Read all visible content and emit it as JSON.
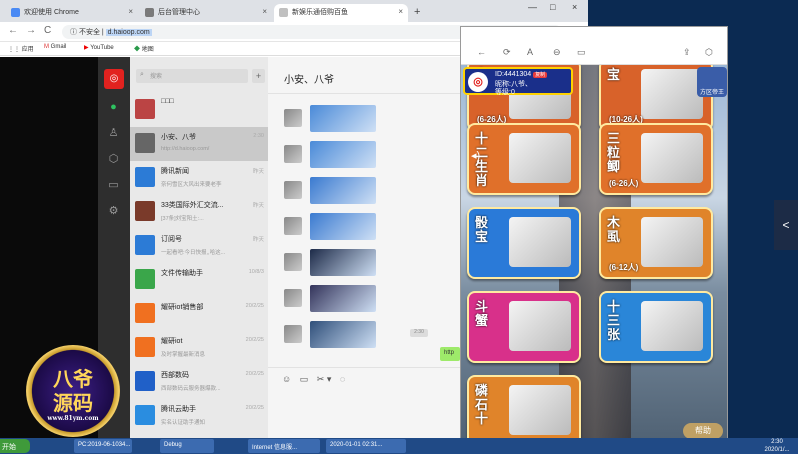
{
  "browser": {
    "tabs": [
      {
        "label": "欢迎使用 Chrome",
        "close": "×"
      },
      {
        "label": "后台管理中心",
        "close": "×"
      },
      {
        "label": "新娱乐通佰购百鱼",
        "close": "×"
      }
    ],
    "new_tab": "+",
    "window_controls": [
      "—",
      "□",
      "×"
    ],
    "nav": {
      "back": "←",
      "forward": "→",
      "reload": "C"
    },
    "address": {
      "security": "不安全",
      "url": "d.haioop.com"
    },
    "bookmarks": [
      "应用",
      "Gmail",
      "YouTube",
      "地图"
    ]
  },
  "wechat": {
    "nav_icons": [
      "chat-icon",
      "contacts-icon",
      "cube-icon",
      "folder-icon",
      "settings-icon"
    ],
    "search_placeholder": "搜索",
    "plus": "+",
    "chats": [
      {
        "name": "□□□",
        "preview": "",
        "time": "",
        "color": "#b44"
      },
      {
        "name": "小安、八爷",
        "preview": "http://d.haioop.com/",
        "time": "2:30",
        "color": "#666",
        "selected": true
      },
      {
        "name": "腾讯新闻",
        "preview": "奈何雪区大风出来要老李",
        "time": "昨天",
        "color": "#2c7bd6"
      },
      {
        "name": "33类国际外汇交流...",
        "preview": "[37条]刘宝阳土:...",
        "time": "昨天",
        "color": "#7a3a2a"
      },
      {
        "name": "订阅号",
        "preview": "一起看吧:今日快报,,哈这...",
        "time": "昨天",
        "color": "#2c7bd6"
      },
      {
        "name": "文件传输助手",
        "preview": "",
        "time": "10/8/3",
        "color": "#3aa64a"
      },
      {
        "name": "耀研iot销售部",
        "preview": "",
        "time": "20/2/25",
        "color": "#f07020"
      },
      {
        "name": "耀研iot",
        "preview": "及时掌握最新消息",
        "time": "20/2/25",
        "color": "#f07020"
      },
      {
        "name": "西部数码",
        "preview": "西部数码云服务器爆款...",
        "time": "20/2/25",
        "color": "#2060c8"
      },
      {
        "name": "腾讯云助手",
        "preview": "实名认证助手通知",
        "time": "20/2/25",
        "color": "#2a8de0"
      },
      {
        "name": "微信团队",
        "preview": "登录操作通知",
        "time": "20/2/25",
        "color": "#2c7bd6"
      }
    ],
    "chat_title": "小安、八爷",
    "time_label": "2:30",
    "outgoing": "http",
    "tools": [
      "☺",
      "▭",
      "✂",
      "▾",
      "◌"
    ]
  },
  "logo": {
    "line1": "八爷",
    "line2": "源码",
    "url": "www.81ym.com"
  },
  "phone": {
    "icons": [
      "←",
      "⟳",
      "A",
      "⊖",
      "▭",
      "⇪",
      "⬡"
    ],
    "profile": {
      "id": "ID:4441304",
      "badge": "复制",
      "nick": "昵称:八爷、",
      "level": "等级:0"
    },
    "cards": [
      {
        "name": "宝",
        "count": "(6-26人)",
        "bg": "#d8622a"
      },
      {
        "name": "宝",
        "count": "(10-26人)",
        "bg": "#d8622a"
      },
      {
        "name": "十二生肖",
        "count": "",
        "bg": "#e0702a"
      },
      {
        "name": "三粒鲫",
        "count": "(6-26人)",
        "bg": "#e0702a"
      },
      {
        "name": "骰宝",
        "count": "",
        "bg": "#2a7ad8"
      },
      {
        "name": "木虱",
        "count": "(6-12人)",
        "bg": "#e0842a"
      },
      {
        "name": "斗蟹",
        "count": "",
        "bg": "#d8308a"
      },
      {
        "name": "十三张",
        "count": "",
        "bg": "#2a86d8"
      },
      {
        "name": "磷石十",
        "count": "",
        "bg": "#e0842a"
      }
    ],
    "right_labels": [
      "新",
      "方区帝王"
    ],
    "bottom_label": "帮助"
  },
  "taskbar": {
    "start": "开始",
    "items": [
      "PC:2019-06-1034...",
      "Debug",
      "Internet 信息服...",
      "2020-01-01 02:31..."
    ],
    "clock_time": "2:30",
    "clock_date": "2020/1/..."
  },
  "side_toggle": "<"
}
